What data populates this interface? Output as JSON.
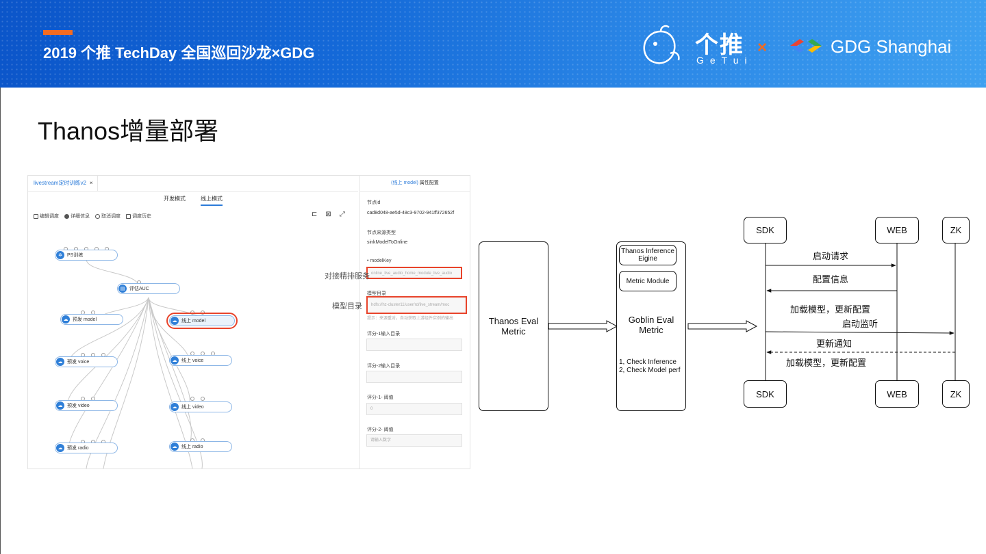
{
  "banner": {
    "event_title": "2019 个推 TechDay 全国巡回沙龙×GDG",
    "getui_name": "个推",
    "getui_sub": "GeTui",
    "times": "×",
    "gdg": "GDG Shanghai",
    "colors": {
      "accent": "#f26b21",
      "blue": "#1469d8"
    }
  },
  "page_title": "Thanos增量部署",
  "app": {
    "tab": {
      "label": "livestream定时训练v2",
      "close": "×"
    },
    "modes": [
      {
        "label": "开发模式"
      },
      {
        "label": "线上模式",
        "active": true
      }
    ],
    "toolbar": [
      {
        "label": "编辑调度",
        "icon": "edit-icon"
      },
      {
        "label": "详细信息",
        "icon": "info-icon"
      },
      {
        "label": "取消调度",
        "icon": "cancel-icon"
      },
      {
        "label": "调度历史",
        "icon": "history-icon"
      }
    ],
    "right_tools": [
      {
        "glyph": "⊏",
        "icon": "crop-icon"
      },
      {
        "glyph": "⊠",
        "icon": "fit-icon"
      },
      {
        "glyph": "⤢",
        "icon": "fullscreen-icon"
      }
    ],
    "nodes": {
      "ps": "PS训练",
      "auc": "评估AUC",
      "pre_model": "预发 model",
      "online_model": "线上 model",
      "pre_voice": "预发 voice",
      "online_voice": "线上 voice",
      "pre_video": "预发 video",
      "online_video": "线上 video",
      "pre_radio": "预发 radio",
      "online_radio": "线上 radio"
    },
    "props": {
      "head_blue": "(线上 model)",
      "head_rest": " 属性配置",
      "node_id_label": "节点id",
      "node_id_value": "cad8d048-ae5d-48c3-9702-941ff372652f",
      "source_type_label": "节点来源类型",
      "source_type_value": "sinkModelToOnline",
      "model_key_label": "• modelKey",
      "model_key_value": "online_live_audio_home_module_live_audio",
      "model_dir_label": "模型目录",
      "model_dir_value": "hdfs://hz-cluster11/user/rd/live_stream/moc",
      "model_dir_hint": "提示：来源重对，自动获取上游组件实例的输出",
      "score1_dir_label": "评分-1输入目录",
      "score2_dir_label": "评分-2输入目录",
      "score1_thr_label": "评分-1- 阈值",
      "score1_thr_value": "0",
      "score2_thr_label": "评分-2- 阈值",
      "score2_thr_placeholder": "请输入数字"
    },
    "ext_labels": {
      "sort_service": "对接精排服务",
      "model_dir": "模型目录"
    }
  },
  "diagram": {
    "thanos_eval": "Thanos Eval Metric",
    "goblin_eval": "Goblin Eval Metric",
    "thanos_inference": "Thanos Inference Eigine",
    "metric_module": "Metric Module",
    "checks": [
      "1, Check Inference",
      "2, Check Model perf"
    ],
    "actors": {
      "sdk": "SDK",
      "web": "WEB",
      "zk": "ZK"
    },
    "messages": {
      "start_request": "启动请求",
      "config_info": "配置信息",
      "load_model": "加载模型，更新配置",
      "start_listen": "启动监听",
      "update_notice": "更新通知",
      "load_model_2": "加载模型，更新配置"
    }
  }
}
